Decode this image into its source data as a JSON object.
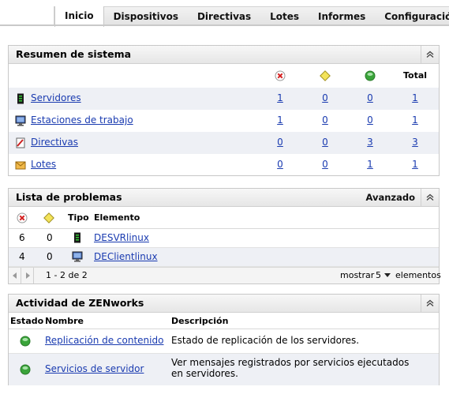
{
  "tabs": [
    {
      "label": "Inicio",
      "active": true
    },
    {
      "label": "Dispositivos"
    },
    {
      "label": "Directivas"
    },
    {
      "label": "Lotes"
    },
    {
      "label": "Informes"
    },
    {
      "label": "Configuración"
    }
  ],
  "summary": {
    "title": "Resumen de sistema",
    "total_label": "Total",
    "rows": [
      {
        "label": "Servidores",
        "icon": "server-icon",
        "error": "1",
        "warning": "0",
        "ok": "0",
        "total": "1"
      },
      {
        "label": "Estaciones de trabajo",
        "icon": "workstation-icon",
        "error": "1",
        "warning": "0",
        "ok": "0",
        "total": "1"
      },
      {
        "label": "Directivas",
        "icon": "policy-icon",
        "error": "0",
        "warning": "0",
        "ok": "3",
        "total": "3"
      },
      {
        "label": "Lotes",
        "icon": "bundle-icon",
        "error": "0",
        "warning": "0",
        "ok": "1",
        "total": "1"
      }
    ]
  },
  "problems": {
    "title": "Lista de problemas",
    "advanced_label": "Avanzado",
    "col_type": "Tipo",
    "col_element": "Elemento",
    "rows": [
      {
        "errors": "6",
        "warnings": "0",
        "icon": "server-icon",
        "element": "DESVRlinux"
      },
      {
        "errors": "4",
        "warnings": "0",
        "icon": "workstation-icon",
        "element": "DEClientlinux"
      }
    ],
    "pager_range": "1 - 2 de 2",
    "show_label": "mostrar",
    "page_size": "5",
    "items_label": "elementos"
  },
  "activity": {
    "title": "Actividad de ZENworks",
    "col_status": "Estado",
    "col_name": "Nombre",
    "col_desc": "Descripción",
    "rows": [
      {
        "status": "ok",
        "name": "Replicación de contenido",
        "desc": "Estado de replicación de los servidores."
      },
      {
        "status": "ok",
        "name": "Servicios de servidor",
        "desc": "Ver mensajes registrados por servicios ejecutados en servidores."
      }
    ]
  },
  "colors": {
    "link": "#1a3bb0",
    "error": "#d42020",
    "warning": "#e8d630",
    "ok": "#3aa43a",
    "alt_row": "#eef0f5"
  }
}
